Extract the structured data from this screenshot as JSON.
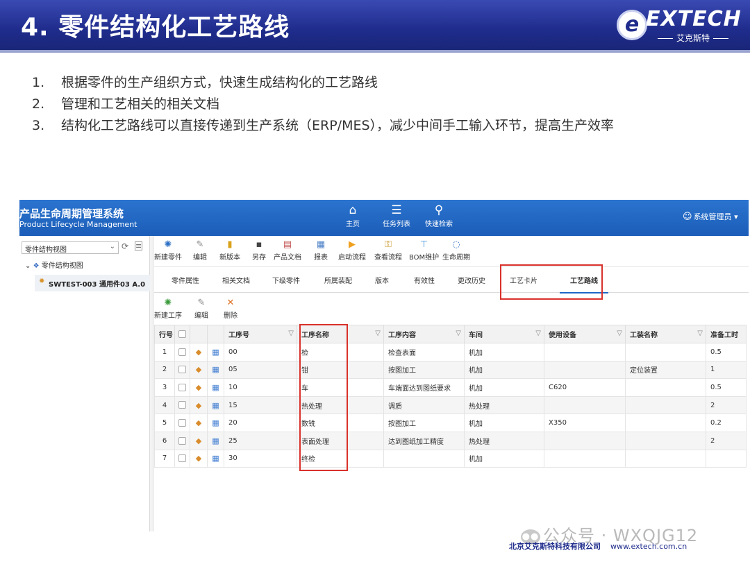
{
  "slide": {
    "title": "4. 零件结构化工艺路线",
    "logo": {
      "mark": "e",
      "word": "EXTECH",
      "sub": "艾克斯特"
    },
    "bullets": [
      {
        "num": "1.",
        "text": "根据零件的生产组织方式，快速生成结构化的工艺路线"
      },
      {
        "num": "2.",
        "text": "管理和工艺相关的相关文档"
      },
      {
        "num": "3.",
        "text": "结构化工艺路线可以直接传递到生产系统（ERP/MES），减少中间手工输入环节，提高生产效率"
      }
    ],
    "watermark": "公众号 · WXQJG12",
    "footer": {
      "company": "北京艾克斯特科技有限公司",
      "url": "www.extech.com.cn"
    }
  },
  "app": {
    "title": "产品生命周期管理系统",
    "subtitle": "Product Lifecycle Management",
    "nav": [
      {
        "label": "主页",
        "icon": "home-icon"
      },
      {
        "label": "任务列表",
        "icon": "task-list-icon"
      },
      {
        "label": "快速检索",
        "icon": "search-icon"
      }
    ],
    "user": "系统管理员",
    "colors": {
      "bar": "#1b5db8",
      "highlight_box": "#d9312b"
    },
    "tree": {
      "select_value": "零件结构视图",
      "root_label": "零件结构视图",
      "node_label": "SWTEST-003 通用件03 A.0"
    },
    "toolbar": [
      {
        "label": "新建零件",
        "icon": "new-part-icon"
      },
      {
        "label": "编辑",
        "icon": "edit-icon"
      },
      {
        "label": "新版本",
        "icon": "new-version-icon"
      },
      {
        "label": "另存",
        "icon": "save-icon"
      },
      {
        "label": "产品文档",
        "icon": "document-icon"
      },
      {
        "label": "报表",
        "icon": "report-icon"
      },
      {
        "label": "启动流程",
        "icon": "start-flow-icon"
      },
      {
        "label": "查看流程",
        "icon": "view-flow-icon"
      },
      {
        "label": "BOM维护",
        "icon": "bom-icon"
      },
      {
        "label": "生命周期",
        "icon": "lifecycle-icon"
      }
    ],
    "tabs": [
      {
        "label": "零件属性"
      },
      {
        "label": "相关文档"
      },
      {
        "label": "下级零件"
      },
      {
        "label": "所属装配"
      },
      {
        "label": "版本"
      },
      {
        "label": "有效性"
      },
      {
        "label": "更改历史"
      },
      {
        "label": "工艺卡片"
      },
      {
        "label": "工艺路线"
      }
    ],
    "active_tab": "工艺路线",
    "subbar": [
      {
        "label": "新建工序",
        "icon": "new-process-icon"
      },
      {
        "label": "编辑",
        "icon": "edit-icon"
      },
      {
        "label": "删除",
        "icon": "delete-icon"
      }
    ],
    "grid": {
      "columns": [
        "行号",
        "",
        "",
        "",
        "工序号",
        "工序名称",
        "工序内容",
        "车间",
        "使用设备",
        "工装名称",
        "准备工时"
      ],
      "rows": [
        {
          "no": "1",
          "code": "00",
          "name": "检",
          "content": "检查表面",
          "shop": "机加",
          "equip": "",
          "fixture": "",
          "prep": "0.5"
        },
        {
          "no": "2",
          "code": "05",
          "name": "钳",
          "content": "按图加工",
          "shop": "机加",
          "equip": "",
          "fixture": "定位装置",
          "prep": "1"
        },
        {
          "no": "3",
          "code": "10",
          "name": "车",
          "content": "车端面达到图纸要求",
          "shop": "机加",
          "equip": "C620",
          "fixture": "",
          "prep": "0.5"
        },
        {
          "no": "4",
          "code": "15",
          "name": "热处理",
          "content": "调质",
          "shop": "热处理",
          "equip": "",
          "fixture": "",
          "prep": "2"
        },
        {
          "no": "5",
          "code": "20",
          "name": "数铣",
          "content": "按图加工",
          "shop": "机加",
          "equip": "X350",
          "fixture": "",
          "prep": "0.2"
        },
        {
          "no": "6",
          "code": "25",
          "name": "表面处理",
          "content": "达到图纸加工精度",
          "shop": "热处理",
          "equip": "",
          "fixture": "",
          "prep": "2"
        },
        {
          "no": "7",
          "code": "30",
          "name": "终检",
          "content": "",
          "shop": "机加",
          "equip": "",
          "fixture": "",
          "prep": ""
        }
      ]
    }
  }
}
